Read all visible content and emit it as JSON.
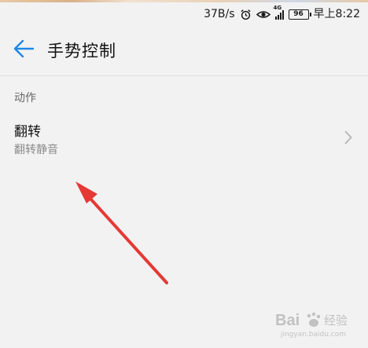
{
  "status_bar": {
    "speed": "37B/s",
    "network": "4G",
    "battery": "96",
    "time": "早上8:22",
    "icons": [
      "alarm-icon",
      "eye-icon",
      "signal-icon",
      "battery-icon"
    ]
  },
  "app_bar": {
    "back_icon": "arrow-left-icon",
    "title": "手势控制"
  },
  "section": {
    "header": "动作"
  },
  "items": [
    {
      "title": "翻转",
      "subtitle": "翻转静音",
      "icon": "chevron-right-icon"
    }
  ],
  "watermark": {
    "brand": "Bai du 经验",
    "url": "jingyan.baidu.com"
  },
  "colors": {
    "accent": "#1e88e5",
    "annotation_arrow": "#e53935",
    "background": "#f2f2f2"
  }
}
